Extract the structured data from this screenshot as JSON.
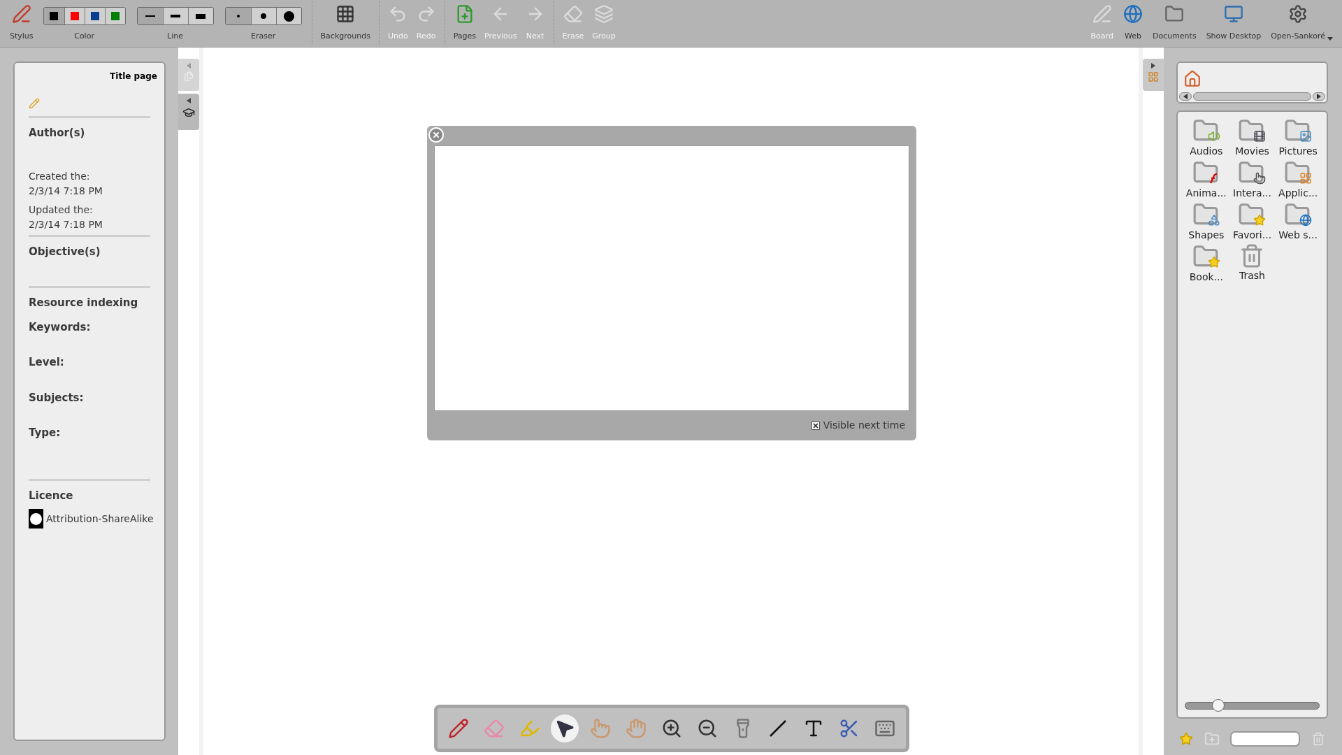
{
  "toolbar": {
    "left": [
      {
        "kind": "button",
        "label": "Stylus",
        "disabled": false
      },
      {
        "kind": "palette",
        "label": "Color",
        "swatches": [
          {
            "color": "#000000",
            "selected": true
          },
          {
            "color": "#ff0000",
            "selected": false
          },
          {
            "color": "#0a3d91",
            "selected": false
          },
          {
            "color": "#008000",
            "selected": false
          }
        ]
      },
      {
        "kind": "lines",
        "label": "Line",
        "options": [
          {
            "selected": true
          },
          {
            "selected": false
          },
          {
            "selected": false
          }
        ]
      },
      {
        "kind": "dots",
        "label": "Eraser",
        "options": [
          {
            "selected": true
          },
          {
            "selected": false
          },
          {
            "selected": false
          }
        ]
      },
      {
        "kind": "separator"
      },
      {
        "kind": "button",
        "label": "Backgrounds",
        "disabled": false
      },
      {
        "kind": "separator"
      },
      {
        "kind": "button",
        "label": "Undo",
        "disabled": true
      },
      {
        "kind": "button",
        "label": "Redo",
        "disabled": true
      },
      {
        "kind": "separator"
      },
      {
        "kind": "button",
        "label": "Pages",
        "disabled": false
      },
      {
        "kind": "button",
        "label": "Previous",
        "disabled": true
      },
      {
        "kind": "button",
        "label": "Next",
        "disabled": true
      },
      {
        "kind": "separator"
      },
      {
        "kind": "button",
        "label": "Erase",
        "disabled": true
      },
      {
        "kind": "button",
        "label": "Group",
        "disabled": true
      }
    ],
    "right": [
      {
        "label": "Board",
        "disabled": true,
        "menu": false
      },
      {
        "label": "Web",
        "disabled": false,
        "menu": false
      },
      {
        "label": "Documents",
        "disabled": false,
        "menu": false
      },
      {
        "label": "Show Desktop",
        "disabled": false,
        "menu": false
      },
      {
        "label": "Open-Sankoré",
        "disabled": false,
        "menu": true
      }
    ]
  },
  "document_panel": {
    "title": "Title page",
    "sections": [
      {
        "kind": "heading",
        "text": "Author(s)"
      },
      {
        "kind": "date",
        "label": "Created the:",
        "value": "2/3/14 7:18 PM"
      },
      {
        "kind": "date",
        "label": "Updated the:",
        "value": "2/3/14 7:18 PM"
      },
      {
        "kind": "rule"
      },
      {
        "kind": "heading",
        "text": "Objective(s)"
      },
      {
        "kind": "rule"
      },
      {
        "kind": "heading",
        "text": "Resource indexing"
      },
      {
        "kind": "field",
        "text": "Keywords:"
      },
      {
        "kind": "field",
        "text": "Level:"
      },
      {
        "kind": "field",
        "text": "Subjects:"
      },
      {
        "kind": "field",
        "text": "Type:"
      },
      {
        "kind": "rule"
      },
      {
        "kind": "heading",
        "text": "Licence"
      },
      {
        "kind": "licence",
        "text": "Attribution-ShareAlike"
      }
    ]
  },
  "dialog": {
    "checkbox": {
      "label": "Visible next time",
      "checked": true
    }
  },
  "tools": [
    {
      "selected": false
    },
    {
      "selected": false
    },
    {
      "selected": false
    },
    {
      "selected": true
    },
    {
      "selected": false
    },
    {
      "selected": false
    },
    {
      "selected": false
    },
    {
      "selected": false
    },
    {
      "selected": false
    },
    {
      "selected": false
    },
    {
      "selected": false
    },
    {
      "selected": false
    },
    {
      "selected": false
    }
  ],
  "library": {
    "items": [
      {
        "label": "Audios"
      },
      {
        "label": "Movies"
      },
      {
        "label": "Pictures"
      },
      {
        "label": "Anima..."
      },
      {
        "label": "Intera..."
      },
      {
        "label": "Applic..."
      },
      {
        "label": "Shapes"
      },
      {
        "label": "Favori..."
      },
      {
        "label": "Web s..."
      },
      {
        "label": "Book..."
      },
      {
        "label": "Trash"
      }
    ],
    "zoom": {
      "level": 0.25
    }
  }
}
